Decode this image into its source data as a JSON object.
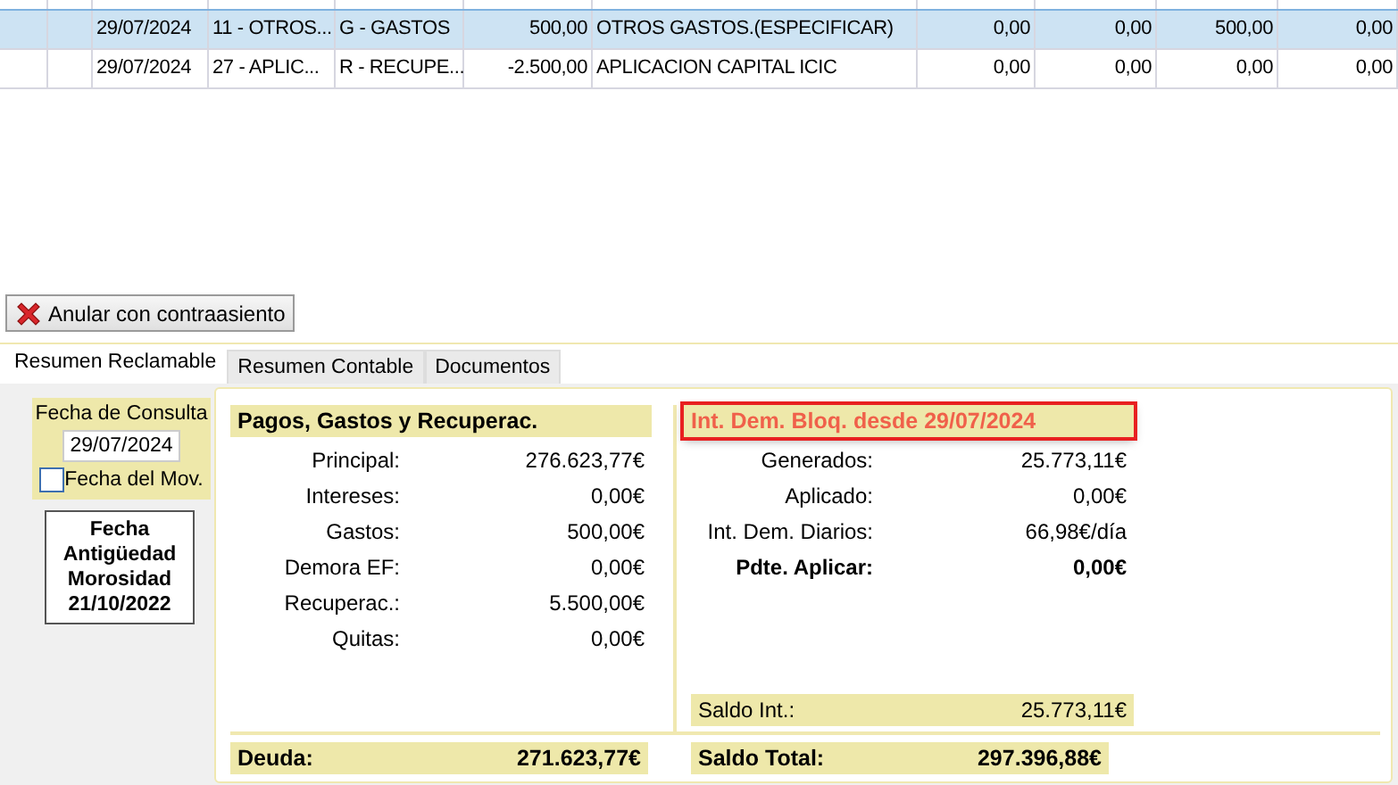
{
  "table": {
    "rows": [
      {
        "selected": true,
        "cells": [
          "",
          "",
          "29/07/2024",
          "11 - OTROS...",
          "G - GASTOS",
          "500,00",
          "OTROS GASTOS.(ESPECIFICAR)",
          "0,00",
          "0,00",
          "500,00",
          "0,00"
        ]
      },
      {
        "selected": false,
        "cells": [
          "",
          "",
          "29/07/2024",
          "27 - APLIC...",
          "R - RECUPE...",
          "-2.500,00",
          "APLICACION CAPITAL ICIC",
          "0,00",
          "0,00",
          "0,00",
          "0,00"
        ]
      }
    ]
  },
  "void_button": {
    "label": "Anular con contraasiento"
  },
  "tabs": [
    {
      "label": "Resumen Reclamable",
      "selected": true
    },
    {
      "label": "Resumen Contable",
      "selected": false
    },
    {
      "label": "Documentos",
      "selected": false
    }
  ],
  "query": {
    "label": "Fecha de Consulta",
    "date": "29/07/2024",
    "move_date": {
      "label": "Fecha del Mov.",
      "checked": false
    }
  },
  "seniority": {
    "lines": [
      "Fecha",
      "Antigüedad",
      "Morosidad",
      "21/10/2022"
    ]
  },
  "payments": {
    "title": "Pagos, Gastos y Recuperac.",
    "rows": [
      {
        "label": "Principal:",
        "value": "276.623,77€"
      },
      {
        "label": "Intereses:",
        "value": "0,00€"
      },
      {
        "label": "Gastos:",
        "value": "500,00€"
      },
      {
        "label": "Demora EF:",
        "value": "0,00€"
      },
      {
        "label": "Recuperac.:",
        "value": "5.500,00€"
      },
      {
        "label": "Quitas:",
        "value": "0,00€"
      }
    ],
    "total": {
      "label": "Deuda:",
      "value": "271.623,77€"
    }
  },
  "interest": {
    "title": "Int. Dem. Bloq. desde 29/07/2024",
    "highlighted": true,
    "rows": [
      {
        "label": "Generados:",
        "value": "25.773,11€",
        "bold": false
      },
      {
        "label": "Aplicado:",
        "value": "0,00€",
        "bold": false
      },
      {
        "label": "Int. Dem. Diarios:",
        "value": "66,98€/día",
        "bold": false
      },
      {
        "label": "Pdte. Aplicar:",
        "value": "0,00€",
        "bold": true
      }
    ],
    "balance": {
      "label": "Saldo Int.:",
      "value": "25.773,11€"
    },
    "total": {
      "label": "Saldo Total:",
      "value": "297.396,88€"
    }
  }
}
